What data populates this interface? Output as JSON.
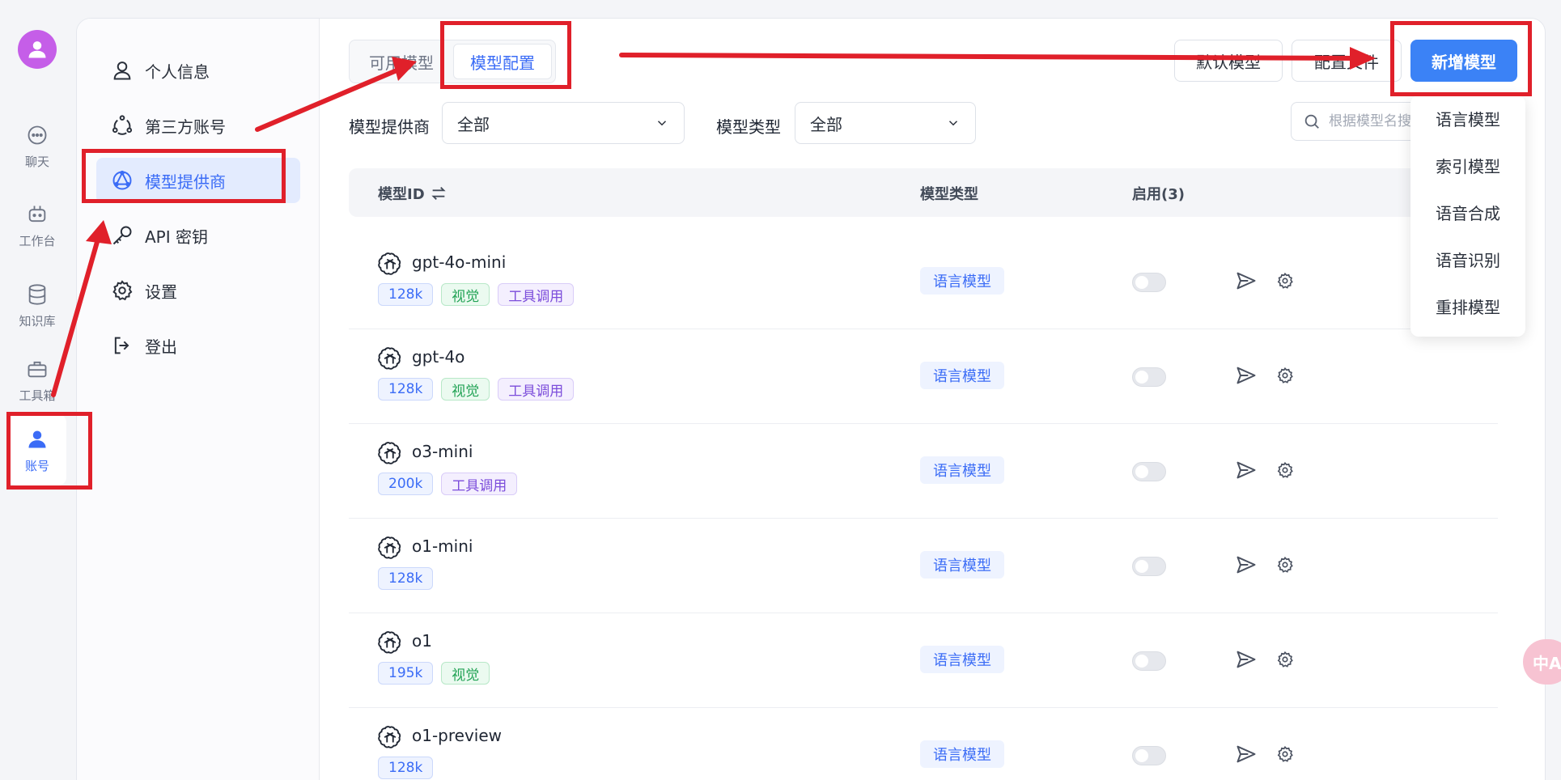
{
  "rail": {
    "items": [
      {
        "label": "聊天",
        "icon": "chat-bubble-icon"
      },
      {
        "label": "工作台",
        "icon": "robot-icon"
      },
      {
        "label": "知识库",
        "icon": "database-icon"
      },
      {
        "label": "工具箱",
        "icon": "toolbox-icon"
      },
      {
        "label": "账号",
        "icon": "user-icon"
      }
    ]
  },
  "menu": {
    "items": [
      {
        "label": "个人信息",
        "icon": "user-outline-icon"
      },
      {
        "label": "第三方账号",
        "icon": "share-circle-icon"
      },
      {
        "label": "模型提供商",
        "icon": "model-provider-icon"
      },
      {
        "label": "API 密钥",
        "icon": "key-icon"
      },
      {
        "label": "设置",
        "icon": "gear-icon"
      },
      {
        "label": "登出",
        "icon": "logout-icon"
      }
    ],
    "active_index": 2
  },
  "tabs": [
    {
      "label": "可用模型"
    },
    {
      "label": "模型配置"
    }
  ],
  "toolbar": {
    "default_model": "默认模型",
    "config_file": "配置文件",
    "add_model": "新增模型"
  },
  "filters": {
    "provider_label": "模型提供商",
    "provider_value": "全部",
    "type_label": "模型类型",
    "type_value": "全部",
    "search_placeholder": "根据模型名搜索"
  },
  "table": {
    "headers": {
      "model_id": "模型ID",
      "model_type": "模型类型",
      "enabled": "启用(3)"
    },
    "rows": [
      {
        "name": "gpt-4o-mini",
        "tags": [
          {
            "text": "128k",
            "kind": "ctx"
          },
          {
            "text": "视觉",
            "kind": "vision"
          },
          {
            "text": "工具调用",
            "kind": "tool"
          }
        ],
        "type": "语言模型",
        "enabled": false
      },
      {
        "name": "gpt-4o",
        "tags": [
          {
            "text": "128k",
            "kind": "ctx"
          },
          {
            "text": "视觉",
            "kind": "vision"
          },
          {
            "text": "工具调用",
            "kind": "tool"
          }
        ],
        "type": "语言模型",
        "enabled": false
      },
      {
        "name": "o3-mini",
        "tags": [
          {
            "text": "200k",
            "kind": "ctx"
          },
          {
            "text": "工具调用",
            "kind": "tool"
          }
        ],
        "type": "语言模型",
        "enabled": false
      },
      {
        "name": "o1-mini",
        "tags": [
          {
            "text": "128k",
            "kind": "ctx"
          }
        ],
        "type": "语言模型",
        "enabled": false
      },
      {
        "name": "o1",
        "tags": [
          {
            "text": "195k",
            "kind": "ctx"
          },
          {
            "text": "视觉",
            "kind": "vision"
          }
        ],
        "type": "语言模型",
        "enabled": false
      },
      {
        "name": "o1-preview",
        "tags": [
          {
            "text": "128k",
            "kind": "ctx"
          }
        ],
        "type": "语言模型",
        "enabled": false
      }
    ]
  },
  "dropdown": {
    "items": [
      "语言模型",
      "索引模型",
      "语音合成",
      "语音识别",
      "重排模型"
    ]
  },
  "float_button": {
    "label": "中A"
  },
  "colors": {
    "accent": "#3b82f6",
    "active_text": "#3b6cf6",
    "annotation_red": "#e0202a",
    "avatar": "#c55ee8"
  }
}
